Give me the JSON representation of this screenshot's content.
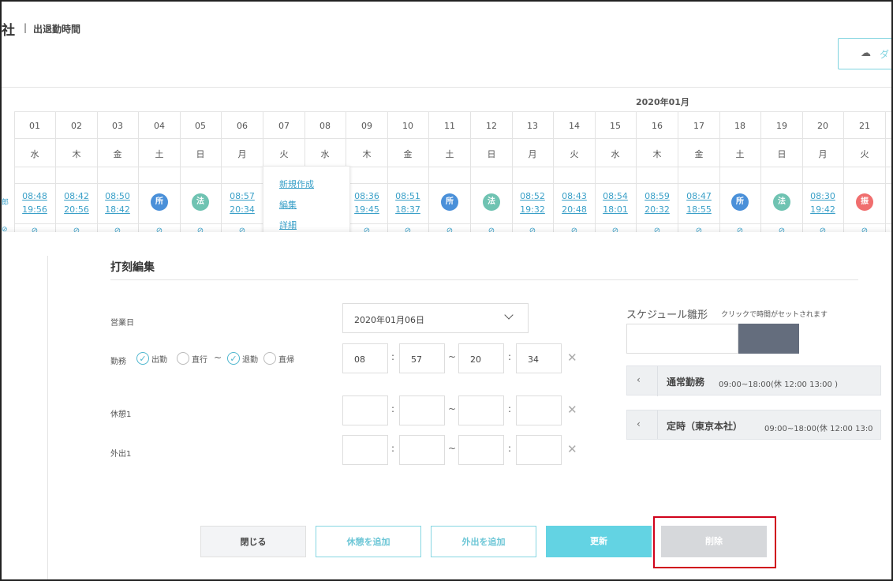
{
  "header": {
    "company_fragment": "社",
    "separator": "|",
    "title": "出退勤時間",
    "download_icon": "cloud-download-icon",
    "download_label": "ダ"
  },
  "calendar": {
    "month": "2020年01月",
    "row_label_fragment": "郎",
    "days": [
      {
        "d": "01",
        "w": "水",
        "in": "08:48",
        "out": "19:56"
      },
      {
        "d": "02",
        "w": "木",
        "in": "08:42",
        "out": "20:56"
      },
      {
        "d": "03",
        "w": "金",
        "in": "08:50",
        "out": "18:42"
      },
      {
        "d": "04",
        "w": "土",
        "badge": "所"
      },
      {
        "d": "05",
        "w": "日",
        "badge": "法"
      },
      {
        "d": "06",
        "w": "月",
        "in": "08:57",
        "out": "20:34"
      },
      {
        "d": "07",
        "w": "火"
      },
      {
        "d": "08",
        "w": "水"
      },
      {
        "d": "09",
        "w": "木",
        "in": "08:36",
        "out": "19:45"
      },
      {
        "d": "10",
        "w": "金",
        "in": "08:51",
        "out": "18:37"
      },
      {
        "d": "11",
        "w": "土",
        "badge": "所"
      },
      {
        "d": "12",
        "w": "日",
        "badge": "法"
      },
      {
        "d": "13",
        "w": "月",
        "in": "08:52",
        "out": "19:32"
      },
      {
        "d": "14",
        "w": "火",
        "in": "08:43",
        "out": "20:48"
      },
      {
        "d": "15",
        "w": "水",
        "in": "08:54",
        "out": "18:01"
      },
      {
        "d": "16",
        "w": "木",
        "in": "08:59",
        "out": "20:32"
      },
      {
        "d": "17",
        "w": "金",
        "in": "08:47",
        "out": "18:55"
      },
      {
        "d": "18",
        "w": "土",
        "badge": "所"
      },
      {
        "d": "19",
        "w": "日",
        "badge": "法"
      },
      {
        "d": "20",
        "w": "月",
        "in": "08:30",
        "out": "19:42"
      },
      {
        "d": "21",
        "w": "火",
        "badge": "振"
      }
    ],
    "popup": {
      "create": "新規作成",
      "edit": "編集",
      "detail": "詳細"
    }
  },
  "modal": {
    "title": "打刻編集",
    "labels": {
      "business_day": "営業日",
      "work": "勤務",
      "break1": "休憩1",
      "out1": "外出1"
    },
    "business_day_value": "2020年01月06日",
    "checks": {
      "clock_in": "出勤",
      "direct_go": "直行",
      "clock_out": "退勤",
      "direct_return": "直帰"
    },
    "tilde": "~",
    "colon": ":",
    "work_times": {
      "in_h": "08",
      "in_m": "57",
      "out_h": "20",
      "out_m": "34"
    },
    "schedule": {
      "title": "スケジュール雛形",
      "subtitle": "クリックで時間がセットされます",
      "templates": [
        {
          "arrow": "‹",
          "name": "通常勤務",
          "time": "09:00~18:00(休 12:00 13:00 )"
        },
        {
          "arrow": "‹",
          "name": "定時（東京本社）",
          "time": "09:00~18:00(休 12:00 13:0"
        }
      ]
    },
    "buttons": {
      "close": "閉じる",
      "add_break": "休憩を追加",
      "add_out": "外出を追加",
      "update": "更新",
      "delete": "削除"
    }
  },
  "colors": {
    "accent": "#63d3e3",
    "link": "#3aa0c8",
    "badge_blue": "#4a90d9",
    "badge_teal": "#6fc3b2",
    "badge_red": "#f06e6e",
    "highlight": "#d0021b"
  }
}
